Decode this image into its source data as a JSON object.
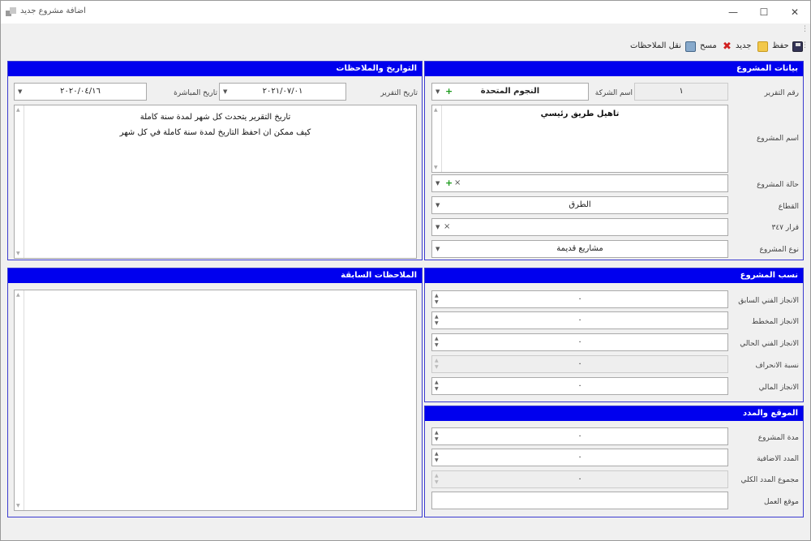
{
  "window": {
    "title": "اضافة مشروع جديد",
    "min": "—",
    "max": "☐",
    "close": "✕"
  },
  "toolbar": {
    "save": "حفظ",
    "new": "جديد",
    "clear": "مسح",
    "transfer": "نقل الملاحظات"
  },
  "project_data": {
    "header": "بيانات المشروع",
    "report_no_label": "رقم التقرير",
    "report_no": "١",
    "company_label": "اسم الشركة",
    "company": "النجوم المتحدة",
    "name_label": "اسم المشروع",
    "name": "تاهيل طريق رئيسي",
    "status_label": "حالة المشروع",
    "status": "",
    "sector_label": "القطاع",
    "sector": "الطرق",
    "decision_label": "قرار ٣٤٧",
    "decision": "",
    "type_label": "نوع المشروع",
    "type": "مشاريع قديمة"
  },
  "dates": {
    "header": "التواريخ والملاحظات",
    "report_date_label": "تاريخ التقرير",
    "report_date": "٢٠٢١/٠٧/٠١",
    "start_date_label": "تاريخ المباشرة",
    "start_date": "٢٠٢٠/٠٤/١٦",
    "notes_line1": "تاريخ التقرير يتحدث كل شهر لمدة سنة كاملة",
    "notes_line2": "كيف ممكن ان احفظ التاريخ لمدة سنة كاملة في كل شهر"
  },
  "previous_notes": {
    "header": "الملاحظات السابقة",
    "text": ""
  },
  "ratios": {
    "header": "نسب المشروع",
    "items": [
      {
        "label": "الانجاز الفني السابق",
        "value": "٠"
      },
      {
        "label": "الانجاز المخطط",
        "value": "٠"
      },
      {
        "label": "الانجاز الفني الحالي",
        "value": "٠"
      },
      {
        "label": "نسبة الانحراف",
        "value": "٠"
      },
      {
        "label": "الانجاز المالي",
        "value": "٠"
      }
    ]
  },
  "location": {
    "header": "الموقع والمدد",
    "items": [
      {
        "label": "مدة المشروع",
        "value": "٠"
      },
      {
        "label": "المدد الاضافية",
        "value": "٠"
      },
      {
        "label": "مجموع المدد الكلي",
        "value": "٠"
      }
    ],
    "site_label": "موقع العمل",
    "site": ""
  },
  "colors": {
    "group_header": "#0000ee"
  }
}
